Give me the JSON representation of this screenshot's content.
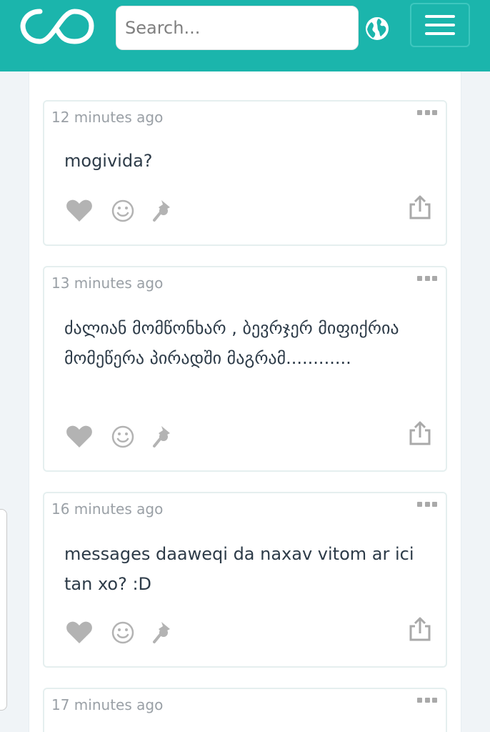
{
  "header": {
    "search_placeholder": "Search...",
    "brand_color": "#1bb5ac",
    "icons": {
      "logo": "infinity-logo",
      "globe": "globe-icon",
      "menu": "hamburger-menu-icon"
    }
  },
  "posts": [
    {
      "time": "12 minutes ago",
      "text": "mogivida?"
    },
    {
      "time": "13 minutes ago",
      "text": "ძალიან მომწონხარ , ბევრჯერ მიფიქრია მომეწერა პირადში მაგრამ............"
    },
    {
      "time": "16 minutes ago",
      "text": "messages daaweqi da naxav vitom ar ici tan xo? :D"
    },
    {
      "time": "17 minutes ago",
      "text": ""
    }
  ],
  "post_action_icons": [
    "heart-icon",
    "smile-icon",
    "pin-icon",
    "share-icon",
    "more-dots-icon"
  ]
}
